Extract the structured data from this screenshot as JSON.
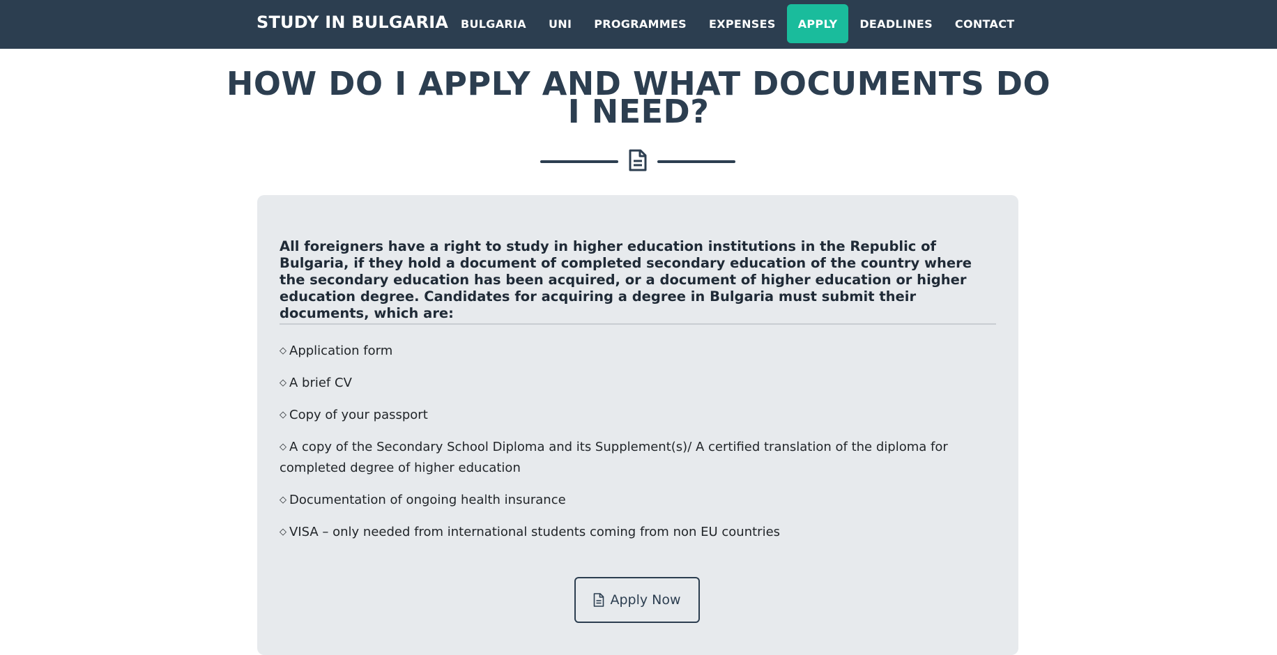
{
  "brand": "STUDY IN BULGARIA",
  "nav": [
    {
      "label": "BULGARIA",
      "active": false
    },
    {
      "label": "UNI",
      "active": false
    },
    {
      "label": "PROGRAMMES",
      "active": false
    },
    {
      "label": "EXPENSES",
      "active": false
    },
    {
      "label": "APPLY",
      "active": true
    },
    {
      "label": "DEADLINES",
      "active": false
    },
    {
      "label": "CONTACT",
      "active": false
    }
  ],
  "page": {
    "title": "HOW DO I APPLY AND WHAT DOCUMENTS DO I NEED?",
    "divider_icon": "document-icon"
  },
  "card": {
    "intro": "All foreigners have a right to study in higher education institutions in the Republic of Bulgaria, if they hold a document of completed secondary education of the country where the secondary education has been acquired, or a document of higher education or higher education degree. Candidates for acquiring a degree in Bulgaria must submit their documents, which are:",
    "bullet": "◇",
    "documents": [
      "Application form",
      "A brief CV",
      "Copy of your passport",
      "A copy of the Secondary School Diploma and its Supplement(s)/ A certified translation of the diploma for completed degree of higher education",
      "Documentation of ongoing health insurance",
      "VISA – only needed from international students coming from non EU countries"
    ],
    "apply_button": {
      "label": "Apply Now",
      "icon": "document-icon"
    }
  },
  "colors": {
    "navbar": "#2c3e50",
    "accent": "#1abc9c",
    "card_bg": "#e7eaed",
    "heading": "#2c3e50"
  }
}
